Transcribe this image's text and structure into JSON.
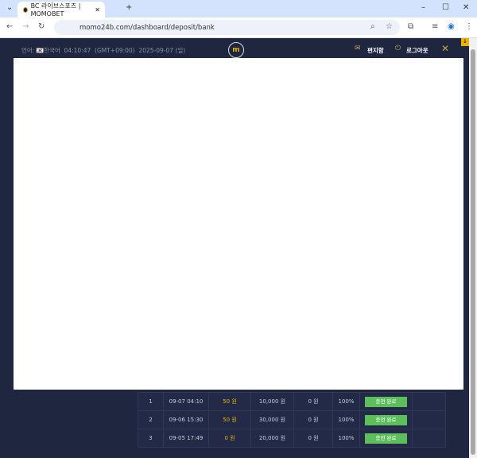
{
  "browser": {
    "tab_title": "BC 라이브스포즈 | MOMOBET",
    "url": "momo24b.com/dashboard/deposit/bank"
  },
  "header": {
    "language_label": "언어:",
    "language": "한국어",
    "time": "04:10:47",
    "timezone": "(GMT+09:00)",
    "date": "2025-09-07 (일)",
    "logo": "m",
    "mail": "편지함",
    "logout": "로그아웃"
  },
  "table": {
    "rows": [
      {
        "no": "1",
        "datetime": "09-07 04:10",
        "bonus": "50 원",
        "amount": "10,000 원",
        "fee": "0 원",
        "rate": "100%",
        "status": "충전 완료"
      },
      {
        "no": "2",
        "datetime": "09-06 15:30",
        "bonus": "50 원",
        "amount": "30,000 원",
        "fee": "0 원",
        "rate": "100%",
        "status": "충전 완료"
      },
      {
        "no": "3",
        "datetime": "09-05 17:49",
        "bonus": "0 원",
        "amount": "20,000 원",
        "fee": "0 원",
        "rate": "100%",
        "status": "충전 완료"
      }
    ]
  }
}
